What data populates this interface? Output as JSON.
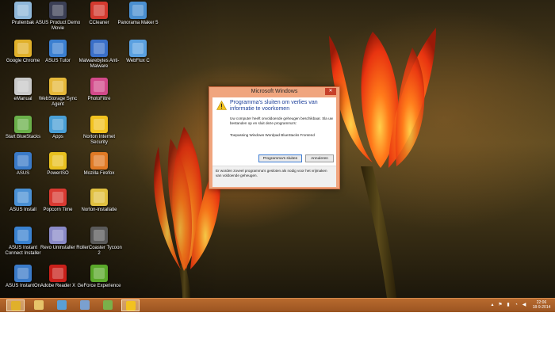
{
  "desktop": {
    "icons": [
      {
        "label": "Prullenbak",
        "name": "recycle-bin-icon",
        "color": "#8fb7d9"
      },
      {
        "label": "ASUS Product Demo Movie",
        "name": "asus-demo-movie-icon",
        "color": "#3b3f55"
      },
      {
        "label": "CCleaner",
        "name": "ccleaner-icon",
        "color": "#d43a2f"
      },
      {
        "label": "Panorama Maker 5",
        "name": "panorama-maker-icon",
        "color": "#4a8fd0"
      },
      {
        "label": "Google Chrome",
        "name": "google-chrome-icon",
        "color": "#e0b02a"
      },
      {
        "label": "ASUS Tutor",
        "name": "asus-tutor-icon",
        "color": "#3b7fd0"
      },
      {
        "label": "Malwarebytes Anti-Malware",
        "name": "malwarebytes-icon",
        "color": "#3a6fc8"
      },
      {
        "label": "WebFlux C",
        "name": "webflux-icon",
        "color": "#5aa0e0"
      },
      {
        "label": "eManual",
        "name": "emanual-icon",
        "color": "#c9c9c9"
      },
      {
        "label": "WebStorage Sync Agent",
        "name": "webstorage-sync-icon",
        "color": "#e6b83a"
      },
      {
        "label": "PhotoFiltre",
        "name": "photofiltre-icon",
        "color": "#d24a8a"
      },
      {
        "label": "Start BlueStacks",
        "name": "start-bluestacks-icon",
        "color": "#6ab04a"
      },
      {
        "label": "Apps",
        "name": "apps-icon",
        "color": "#4a9fd6"
      },
      {
        "label": "Norton Internet Security",
        "name": "norton-internet-security-icon",
        "color": "#f2c21f"
      },
      {
        "label": "ASUS",
        "name": "asus-icon",
        "color": "#3a7ac8"
      },
      {
        "label": "PowerISO",
        "name": "poweriso-icon",
        "color": "#e8c020"
      },
      {
        "label": "Mozilla Firefox",
        "name": "mozilla-firefox-icon",
        "color": "#e07a25"
      },
      {
        "label": "ASUS Install",
        "name": "asus-install-icon",
        "color": "#4a90d4"
      },
      {
        "label": "Popcorn Time",
        "name": "popcorn-time-icon",
        "color": "#d93a32"
      },
      {
        "label": "Norton-installatie",
        "name": "norton-installatie-icon",
        "color": "#e0c040"
      },
      {
        "label": "ASUS Instant Connect Installer",
        "name": "asus-instant-connect-icon",
        "color": "#3a82d0"
      },
      {
        "label": "Revo Uninstaller",
        "name": "revo-uninstaller-icon",
        "color": "#8a8ac8"
      },
      {
        "label": "RollerCoaster Tycoon 2",
        "name": "rollercoaster-tycoon-icon",
        "color": "#5a5a5a"
      },
      {
        "label": "ASUS InstantOn",
        "name": "asus-instanton-icon",
        "color": "#3a7ac8"
      },
      {
        "label": "Adobe Reader X",
        "name": "adobe-reader-icon",
        "color": "#c8201a"
      },
      {
        "label": "GeForce Experience",
        "name": "geforce-experience-icon",
        "color": "#5aa82a"
      }
    ]
  },
  "dialog": {
    "title": "Microsoft Windows",
    "close_glyph": "✕",
    "heading": "Programma's sluiten om verlies van informatie te voorkomen",
    "message": "Uw computer heeft onvoldoende geheugen beschikbaar. Sla uw bestanden op en sluit deze programma's:",
    "programs": "Toepassing Windows Wordpad BlueStacks Frontend",
    "close_programs_button": "Programma's sluiten",
    "cancel_button": "Annuleren",
    "footer": "Er worden zoveel programma's gesloten als nodig voor het vrijmaken van voldoende geheugen."
  },
  "taskbar": {
    "items": [
      {
        "name": "taskbar-chrome",
        "icon": "chrome-icon",
        "color": "#e0b02a",
        "active": true
      },
      {
        "name": "taskbar-explorer",
        "icon": "folder-icon",
        "color": "#e6c46a",
        "active": false
      },
      {
        "name": "taskbar-photos",
        "icon": "photos-icon",
        "color": "#5a9fd6",
        "active": false
      },
      {
        "name": "taskbar-wordpad",
        "icon": "wordpad-icon",
        "color": "#7aa0d0",
        "active": false
      },
      {
        "name": "taskbar-bluestacks",
        "icon": "bluestacks-icon",
        "color": "#7ab04a",
        "active": false
      },
      {
        "name": "taskbar-warning",
        "icon": "warning-icon",
        "color": "#f2c21f",
        "active": true
      }
    ],
    "tray": {
      "time": "22:06",
      "date": "18-9-2014"
    }
  }
}
